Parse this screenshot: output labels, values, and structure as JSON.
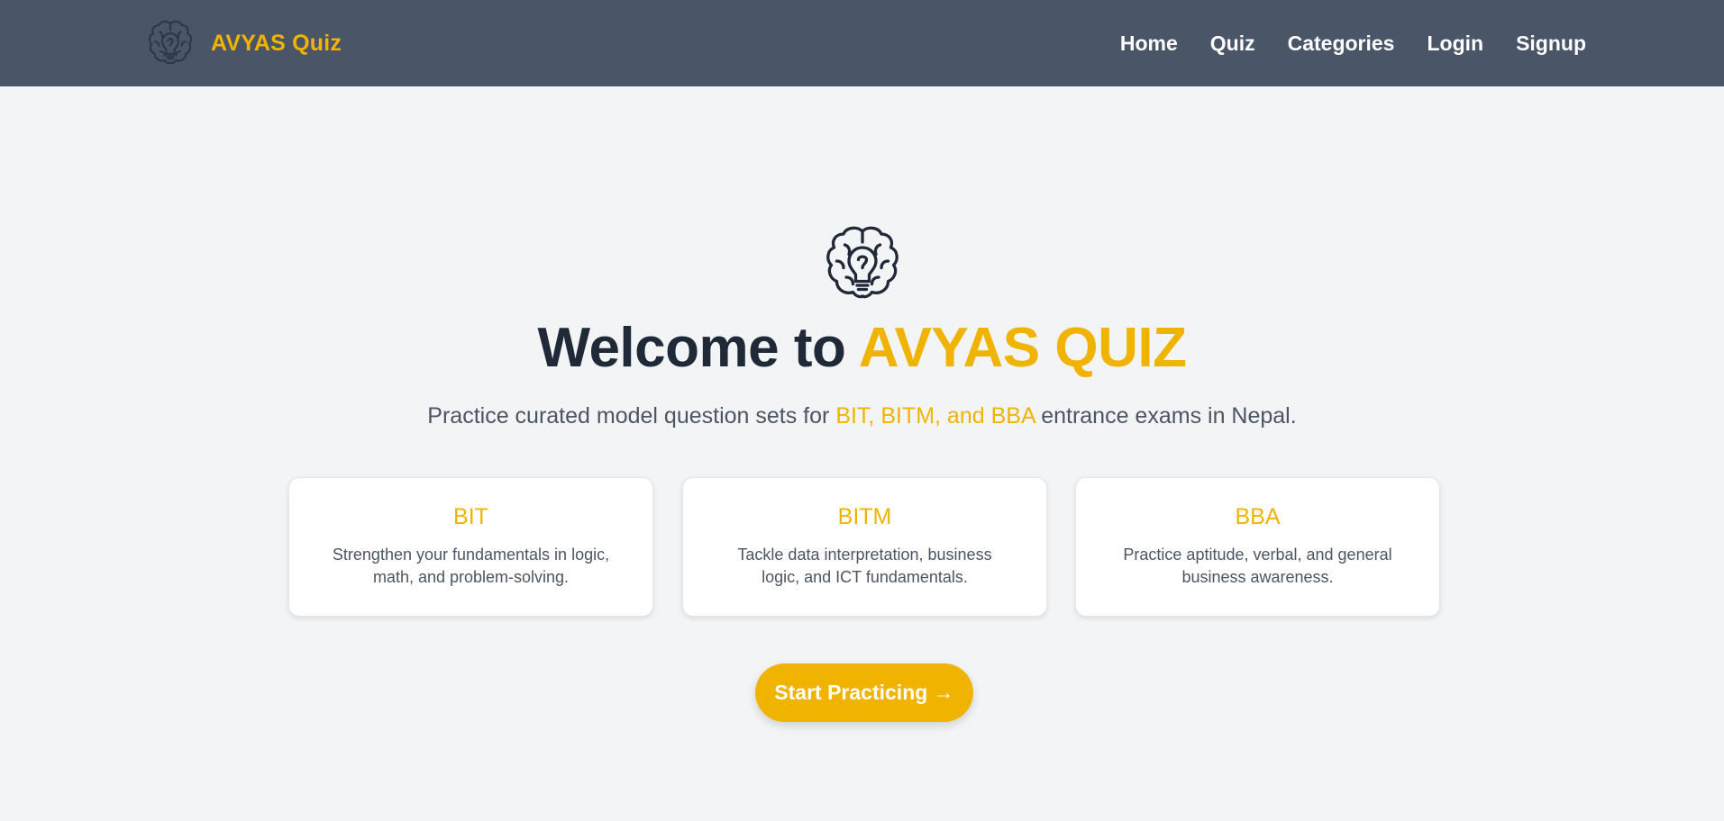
{
  "header": {
    "brand_name": "AVYAS Quiz",
    "logo_icon": "brain-lightbulb-icon",
    "nav": [
      {
        "label": "Home"
      },
      {
        "label": "Quiz"
      },
      {
        "label": "Categories"
      },
      {
        "label": "Login"
      },
      {
        "label": "Signup"
      }
    ]
  },
  "hero": {
    "icon": "brain-lightbulb-icon",
    "title_prefix": "Welcome to ",
    "title_accent": "AVYAS QUIZ",
    "subtitle_prefix": "Practice curated model question sets for ",
    "subtitle_highlight": "BIT, BITM, and BBA",
    "subtitle_suffix": " entrance exams in Nepal."
  },
  "cards": [
    {
      "title": "BIT",
      "description": "Strengthen your fundamentals in logic, math, and problem-solving."
    },
    {
      "title": "BITM",
      "description": "Tackle data interpretation, business logic, and ICT fundamentals."
    },
    {
      "title": "BBA",
      "description": "Practice aptitude, verbal, and general business awareness."
    }
  ],
  "cta": {
    "label": "Start Practicing →"
  },
  "colors": {
    "header_bg": "#4a5568",
    "page_bg": "#f3f4f6",
    "accent": "#f0b400",
    "heading": "#1f2937",
    "body_text": "#4b5563",
    "card_bg": "#ffffff"
  }
}
